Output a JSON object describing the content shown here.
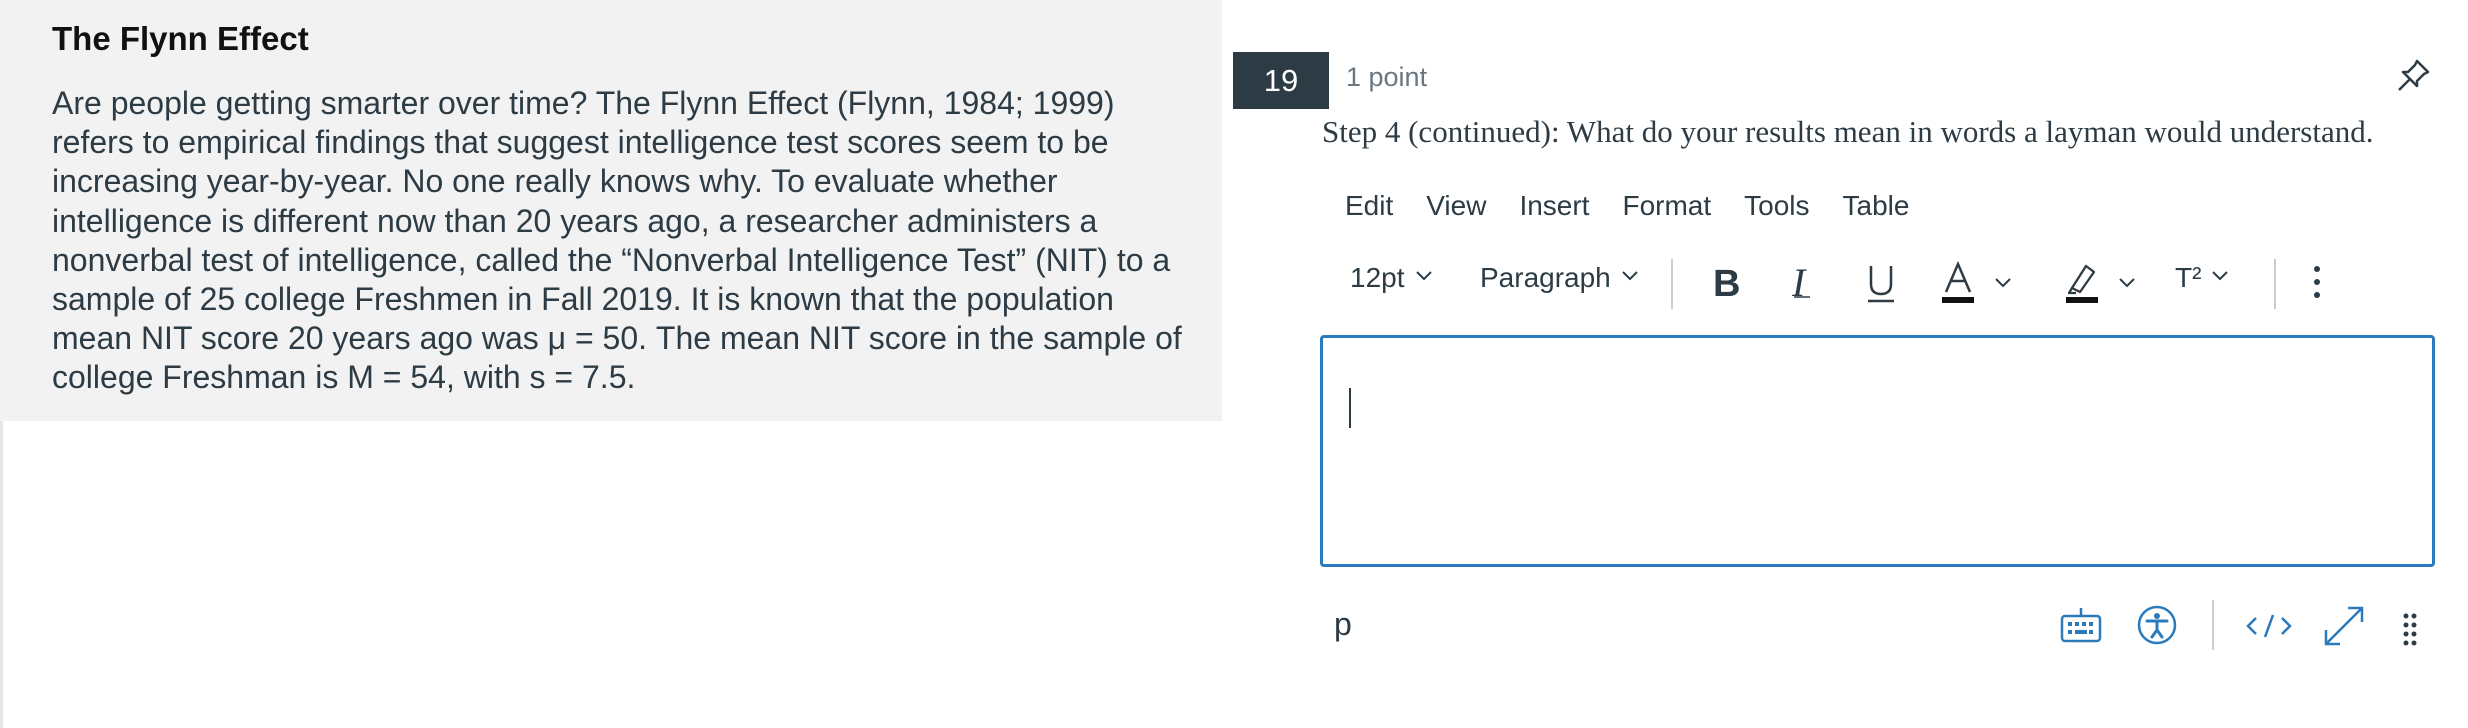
{
  "passage": {
    "title": "The Flynn Effect",
    "body": "Are people getting smarter over time?  The Flynn Effect (Flynn, 1984; 1999) refers to empirical findings that suggest intelligence test scores seem to be increasing year-by-year.  No one really knows why.  To evaluate whether intelligence is different now than 20 years ago, a researcher administers a nonverbal test of intelligence, called the “Nonverbal Intelligence Test” (NIT) to a sample of 25 college Freshmen in Fall 2019.  It is known that the population mean NIT score 20 years ago was μ = 50.  The mean NIT score in the sample of college Freshman is M = 54, with s = 7.5."
  },
  "question": {
    "number": "19",
    "points": "1 point",
    "prompt": "Step 4 (continued):  What do your results mean in words a layman would understand."
  },
  "menubar": {
    "items": [
      "Edit",
      "View",
      "Insert",
      "Format",
      "Tools",
      "Table"
    ]
  },
  "toolbar": {
    "font_size": "12pt",
    "block_format": "Paragraph",
    "superscript_label": "T²"
  },
  "editor": {
    "content": ""
  },
  "statusbar": {
    "path": "p"
  },
  "colors": {
    "accent": "#2b7abc",
    "question_badge": "#2d3b45",
    "passage_bg": "#f2f2f2",
    "text": "#2d3b45"
  },
  "icons": [
    "pin-icon",
    "bold-icon",
    "italic-icon",
    "underline-icon",
    "text-color-icon",
    "highlight-icon",
    "superscript-icon",
    "more-icon",
    "keyboard-icon",
    "accessibility-icon",
    "html-editor-icon",
    "fullscreen-icon",
    "resize-handle-icon"
  ]
}
